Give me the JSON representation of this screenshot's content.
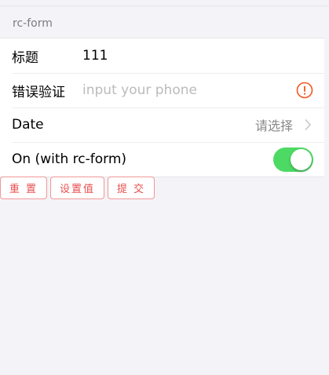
{
  "list": {
    "header": "rc-form",
    "rows": {
      "title": {
        "label": "标题",
        "value": "111"
      },
      "error": {
        "label": "错误验证",
        "placeholder": "input your phone",
        "icon": "error-circle-icon",
        "icon_color": "#f4561d"
      },
      "date": {
        "label": "Date",
        "extra": "请选择",
        "icon": "chevron-right-icon"
      },
      "switch": {
        "label": "On (with rc-form)",
        "checked": true,
        "color": "#4cd964"
      }
    }
  },
  "buttons": {
    "reset": "重 置",
    "set_value": "设置值",
    "submit": "提 交",
    "color": "#e94f4f"
  }
}
